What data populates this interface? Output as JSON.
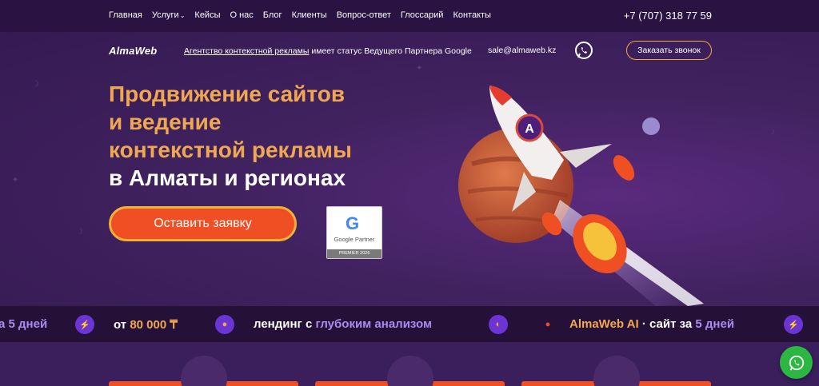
{
  "topnav": {
    "items": [
      "Главная",
      "Услуги",
      "Кейсы",
      "О нас",
      "Блог",
      "Клиенты",
      "Вопрос-ответ",
      "Глоссарий",
      "Контакты"
    ],
    "phone": "+7 (707) 318 77 59"
  },
  "header": {
    "logo": "AlmaWeb",
    "partner_link": "Агентство контекстной рекламы",
    "partner_rest": " имеет статус Ведущего Партнера Google",
    "email": "sale@almaweb.kz",
    "callback_label": "Заказать звонок"
  },
  "hero": {
    "line1": "Продвижение сайтов",
    "line2": "и ведение",
    "line3": "контекстной рекламы",
    "line4": "в Алматы и регионах",
    "cta_label": "Оставить заявку",
    "badge_brand": "Google Partner",
    "badge_premier": "PREMIER 2026"
  },
  "marquee": {
    "item1_a": "а ",
    "item1_b": "5 дней",
    "item2_a": "от ",
    "item2_b": "80 000 ₸",
    "item3_a": "лендинг с ",
    "item3_b": "глубоким анализом",
    "item4_a": "AlmaWeb AI",
    "item4_b": " · сайт за ",
    "item4_c": "5 дней"
  },
  "colors": {
    "accent_orange": "#f0a850",
    "cta_red": "#f04e23",
    "bg_purple": "#3a1f5c",
    "whatsapp_green": "#2bb741"
  }
}
